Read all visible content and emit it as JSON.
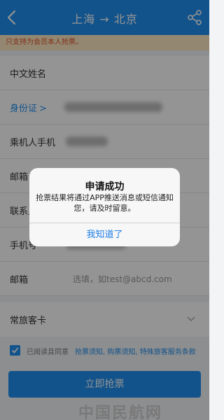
{
  "header": {
    "title": "上海 → 北京",
    "back_icon": "back-chevron-icon",
    "share_icon": "share-icon",
    "color": "#1f8ff0"
  },
  "notice": {
    "text": "只支持为会员本人抢票。",
    "color": "#e0542b",
    "background": "#fde9c3"
  },
  "form": {
    "rows": [
      {
        "label": "中文姓名"
      },
      {
        "label": "身份证",
        "chevron": ">"
      },
      {
        "label": "乘机人手机"
      },
      {
        "label": "邮箱"
      },
      {
        "label": "联系人"
      },
      {
        "label": "手机号"
      },
      {
        "label": "邮箱",
        "placeholder": "选填，如test@abcd.com"
      }
    ],
    "frequent_traveler": {
      "label": "常旅客卡"
    }
  },
  "agreement": {
    "checked": true,
    "text": "已阅读且同意",
    "links": "抢票须知, 购票须知, 特殊旅客服务条款"
  },
  "submit": {
    "label": "立即抢票"
  },
  "watermark": {
    "text": "中国民航网"
  },
  "dialog": {
    "title": "申请成功",
    "message_line1": "抢票结果将通过APP推送消息或短信通知",
    "message_line2": "您，请及时留意。",
    "button": "我知道了"
  }
}
